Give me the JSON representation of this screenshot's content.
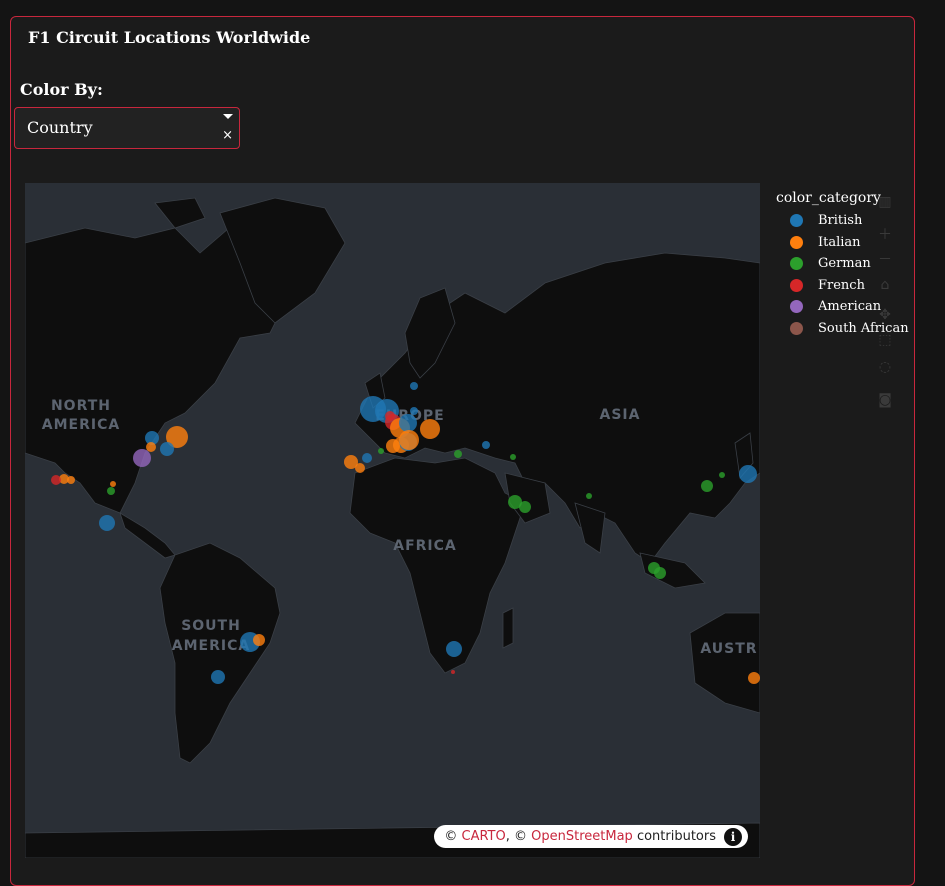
{
  "page": {
    "title": "F1 Circuit Locations Worldwide",
    "color_by_label": "Color By:",
    "color_by_value": "Country",
    "clear_glyph": "×"
  },
  "map": {
    "continent_labels": [
      "NORTH AMERICA",
      "EUROPE",
      "ASIA",
      "AFRICA",
      "SOUTH AMERICA",
      "AUSTR"
    ],
    "attribution": {
      "prefix": "© ",
      "carto": "CARTO",
      "sep": ", © ",
      "osm": "OpenStreetMap",
      "suffix": " contributors",
      "info_glyph": "i"
    }
  },
  "legend": {
    "title": "color_category",
    "items": [
      {
        "label": "British",
        "color": "#1f77b4"
      },
      {
        "label": "Italian",
        "color": "#ff7f0e"
      },
      {
        "label": "German",
        "color": "#2ca02c"
      },
      {
        "label": "French",
        "color": "#d62728"
      },
      {
        "label": "American",
        "color": "#9467bd"
      },
      {
        "label": "South African",
        "color": "#8c564b"
      }
    ]
  },
  "modebar": {
    "icons": [
      "bar-chart-icon",
      "zoom-in-icon",
      "zoom-out-icon",
      "home-icon",
      "pan-icon",
      "box-select-icon",
      "lasso-select-icon",
      "camera-icon"
    ]
  },
  "colors": {
    "accent": "#c8273d",
    "map_water": "#2a2f36",
    "map_land": "#0e0e0e"
  }
}
